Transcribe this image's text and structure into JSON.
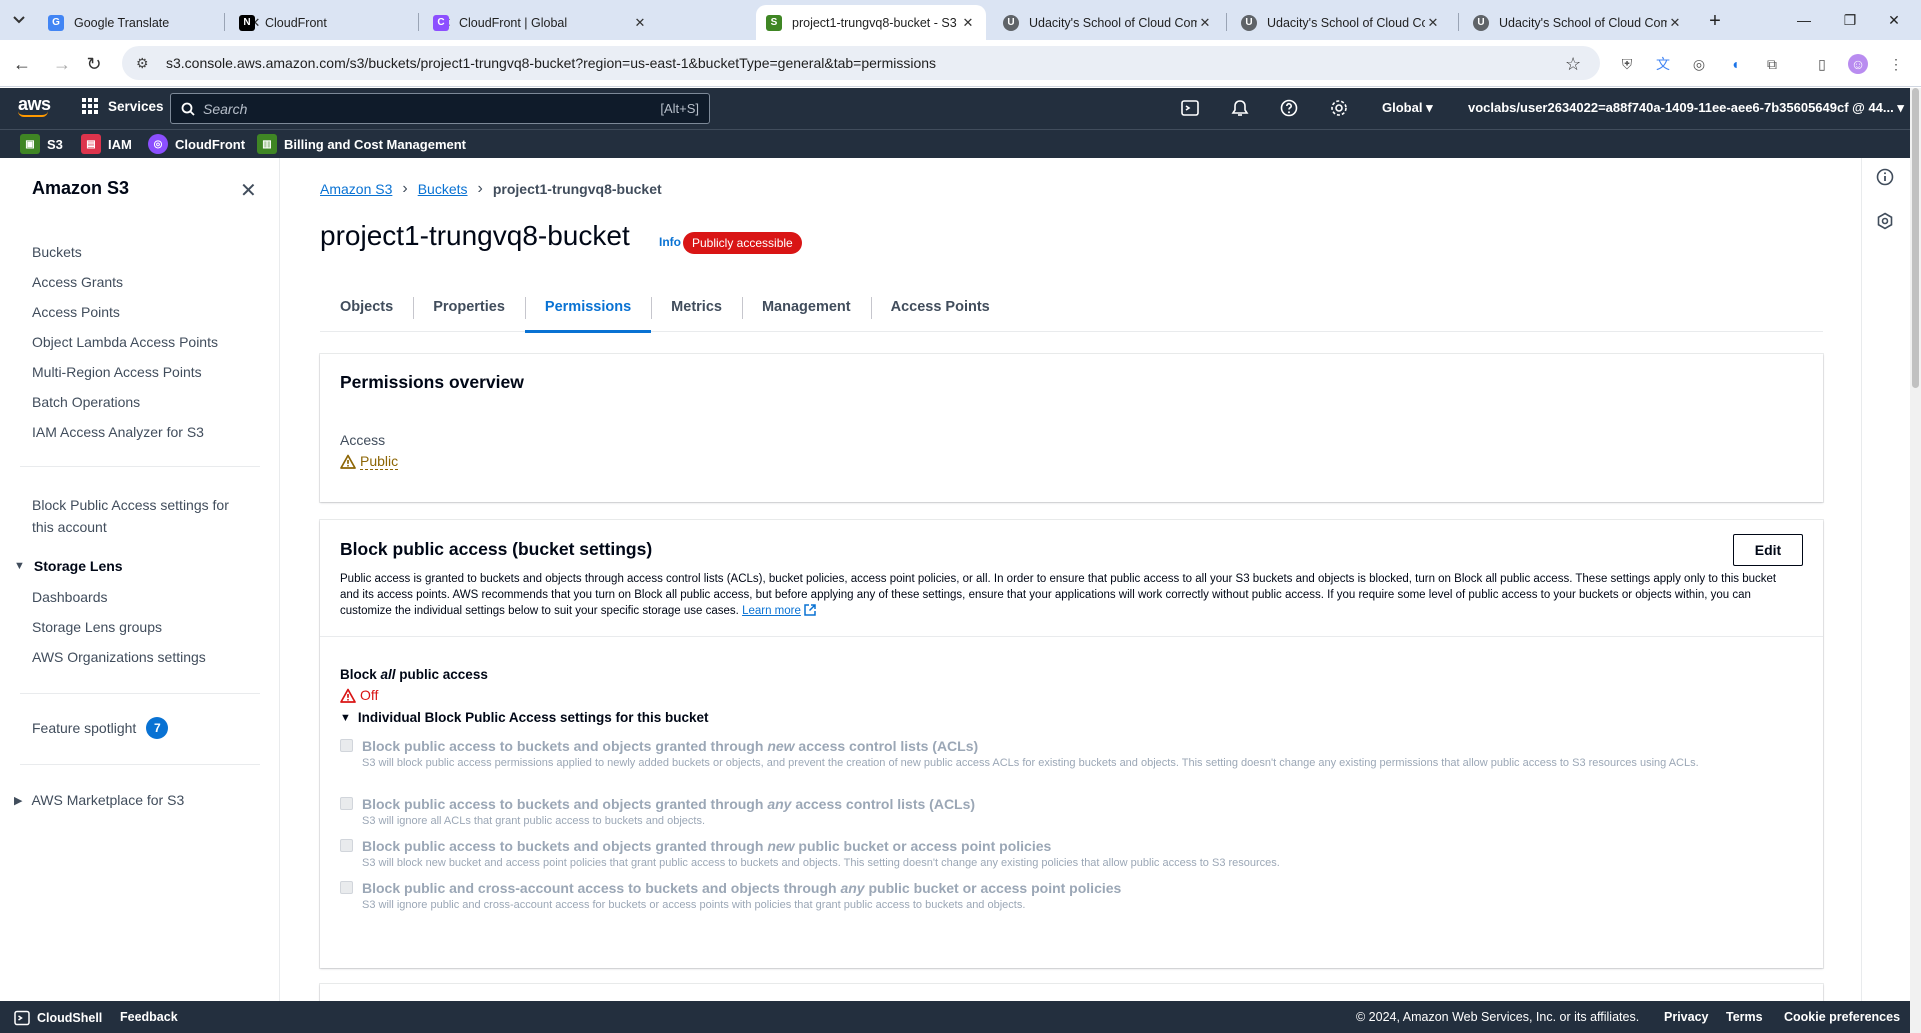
{
  "browser": {
    "tabs": [
      {
        "title": "Google Translate",
        "favicon_color": "#4285f4",
        "favicon": "G"
      },
      {
        "title": "CloudFront",
        "favicon_color": "#000000",
        "favicon": "N"
      },
      {
        "title": "CloudFront | Global",
        "favicon_color": "#8c4fff",
        "favicon": "C"
      },
      {
        "title": "project1-trungvq8-bucket - S3",
        "favicon_color": "#3f8624",
        "favicon": "S"
      },
      {
        "title": "Udacity's School of Cloud Com",
        "favicon_color": "#5f6368",
        "favicon": "U"
      },
      {
        "title": "Udacity's School of Cloud Com",
        "favicon_color": "#5f6368",
        "favicon": "U"
      },
      {
        "title": "Udacity's School of Cloud Com",
        "favicon_color": "#5f6368",
        "favicon": "U"
      }
    ],
    "active_tab": 3,
    "url": "s3.console.aws.amazon.com/s3/buckets/project1-trungvq8-bucket?region=us-east-1&bucketType=general&tab=permissions"
  },
  "aws_header": {
    "services_label": "Services",
    "search_placeholder": "Search",
    "search_shortcut": "[Alt+S]",
    "region": "Global",
    "account": "voclabs/user2634022=a88f740a-1409-11ee-aee6-7b35605649cf @ 44..."
  },
  "favorites": [
    {
      "label": "S3",
      "color": "#3f8624"
    },
    {
      "label": "IAM",
      "color": "#dd344c"
    },
    {
      "label": "CloudFront",
      "color": "#8c4fff"
    },
    {
      "label": "Billing and Cost Management",
      "color": "#3f8624"
    }
  ],
  "sidebar": {
    "title": "Amazon S3",
    "links": [
      "Buckets",
      "Access Grants",
      "Access Points",
      "Object Lambda Access Points",
      "Multi-Region Access Points",
      "Batch Operations",
      "IAM Access Analyzer for S3"
    ],
    "block_public_access_line1": "Block Public Access settings for",
    "block_public_access_line2": "this account",
    "storage_lens": {
      "title": "Storage Lens",
      "links": [
        "Dashboards",
        "Storage Lens groups",
        "AWS Organizations settings"
      ]
    },
    "feature_spotlight": "Feature spotlight",
    "feature_spotlight_count": "7",
    "marketplace": "AWS Marketplace for S3"
  },
  "breadcrumb": [
    "Amazon S3",
    "Buckets",
    "project1-trungvq8-bucket"
  ],
  "page": {
    "title": "project1-trungvq8-bucket",
    "info": "Info",
    "badge": "Publicly accessible",
    "tabs": [
      "Objects",
      "Properties",
      "Permissions",
      "Metrics",
      "Management",
      "Access Points"
    ],
    "active_tab": "Permissions"
  },
  "permissions_overview": {
    "heading": "Permissions overview",
    "access_label": "Access",
    "access_value": "Public"
  },
  "block_public_access": {
    "heading": "Block public access (bucket settings)",
    "edit_label": "Edit",
    "description": "Public access is granted to buckets and objects through access control lists (ACLs), bucket policies, access point policies, or all. In order to ensure that public access to all your S3 buckets and objects is blocked, turn on Block all public access. These settings apply only to this bucket and its access points. AWS recommends that you turn on Block all public access, but before applying any of these settings, ensure that your applications will work correctly without public access. If you require some level of public access to your buckets or objects within, you can customize the individual settings below to suit your specific storage use cases.",
    "learn_more": "Learn more",
    "block_all_prefix": "Block ",
    "block_all_em": "all",
    "block_all_suffix": " public access",
    "block_all_value": "Off",
    "individual_heading": "Individual Block Public Access settings for this bucket",
    "options": [
      {
        "pre": "Block public access to buckets and objects granted through ",
        "em": "new",
        "post": " access control lists (ACLs)",
        "desc": "S3 will block public access permissions applied to newly added buckets or objects, and prevent the creation of new public access ACLs for existing buckets and objects. This setting doesn't change any existing permissions that allow public access to S3 resources using ACLs."
      },
      {
        "pre": "Block public access to buckets and objects granted through ",
        "em": "any",
        "post": " access control lists (ACLs)",
        "desc": "S3 will ignore all ACLs that grant public access to buckets and objects."
      },
      {
        "pre": "Block public access to buckets and objects granted through ",
        "em": "new",
        "post": " public bucket or access point policies",
        "desc": "S3 will block new bucket and access point policies that grant public access to buckets and objects. This setting doesn't change any existing policies that allow public access to S3 resources."
      },
      {
        "pre": "Block public and cross-account access to buckets and objects through ",
        "em": "any",
        "post": " public bucket or access point policies",
        "desc": "S3 will ignore public and cross-account access for buckets or access points with policies that grant public access to buckets and objects."
      }
    ]
  },
  "footer": {
    "cloudshell": "CloudShell",
    "feedback": "Feedback",
    "copyright": "© 2024, Amazon Web Services, Inc. or its affiliates.",
    "privacy": "Privacy",
    "terms": "Terms",
    "cookies": "Cookie preferences"
  },
  "colors": {
    "aws_squid_ink": "#232f3e",
    "link_blue": "#0972d3",
    "error_red": "#d91515",
    "warning_brown": "#8d6605"
  }
}
